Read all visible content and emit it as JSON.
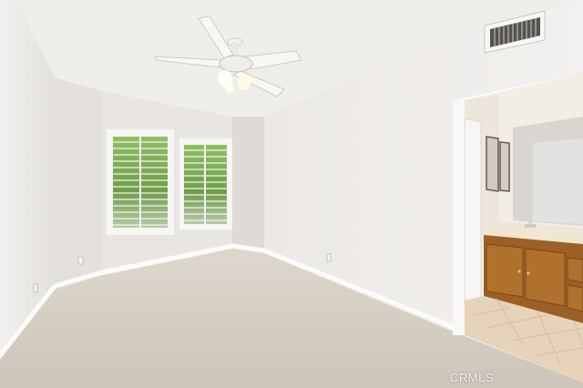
{
  "watermark": {
    "text": "CRMLS"
  },
  "palette": {
    "wall_light": "#eeece9",
    "wall_shadow": "#dcd8d4",
    "ceiling": "#f1efec",
    "carpet": "#ddd7cd",
    "baseboard": "#fbfbfa",
    "cabinet": "#a86a2c",
    "bath_tile": "#e6d4bc",
    "window_green": "#7fae5a"
  }
}
